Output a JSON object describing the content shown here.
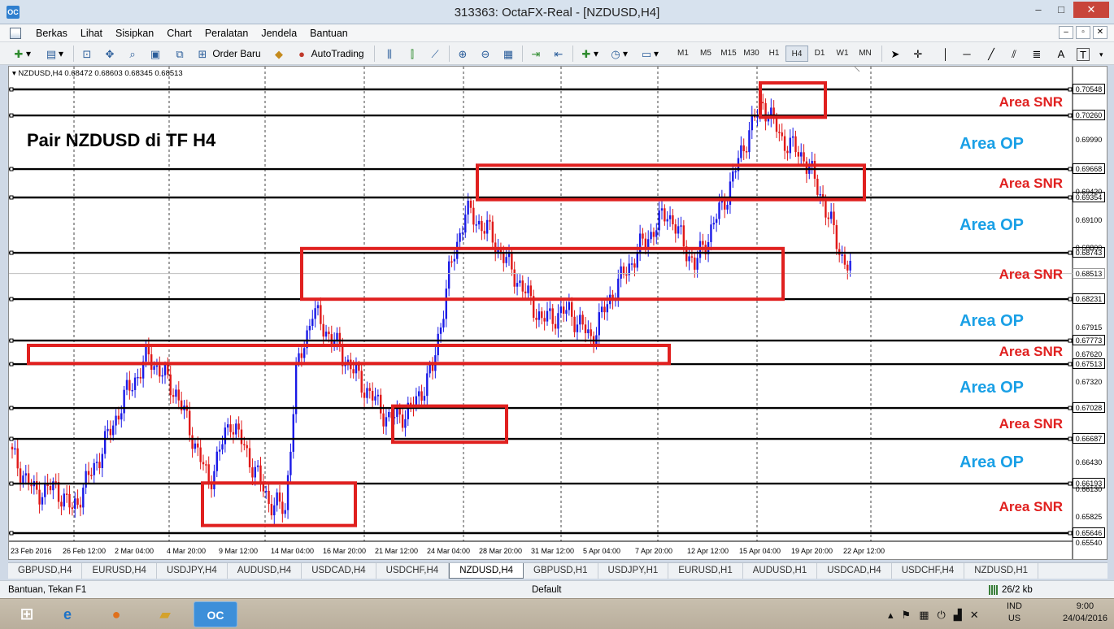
{
  "window": {
    "title": "313363: OctaFX-Real - [NZDUSD,H4]",
    "app_icon": "OC",
    "controls": [
      "–",
      "□",
      "✕"
    ]
  },
  "menu": {
    "items": [
      "Berkas",
      "Lihat",
      "Sisipkan",
      "Chart",
      "Peralatan",
      "Jendela",
      "Bantuan"
    ],
    "mdi_controls": [
      "–",
      "▫",
      "✕"
    ]
  },
  "toolbar": {
    "order_label": "Order Baru",
    "autotrading_label": "AutoTrading",
    "timeframes": [
      "M1",
      "M5",
      "M15",
      "M30",
      "H1",
      "H4",
      "D1",
      "W1",
      "MN"
    ],
    "active_timeframe": "H4",
    "text_tool": "A",
    "label_tool": "T"
  },
  "chart": {
    "symbol_line": "NZDUSD,H4  0.68472 0.68603 0.68345 0.68513",
    "title": "Pair NZDUSD di TF H4",
    "current_price": "0.68513",
    "levels": [
      {
        "price": "0.70548",
        "value": 0.70548
      },
      {
        "price": "0.70260",
        "value": 0.7026
      },
      {
        "price": "0.69668",
        "value": 0.69668
      },
      {
        "price": "0.69354",
        "value": 0.69354
      },
      {
        "price": "0.68743",
        "value": 0.68743
      },
      {
        "price": "0.68231",
        "value": 0.68231
      },
      {
        "price": "0.67773",
        "value": 0.67773
      },
      {
        "price": "0.67513",
        "value": 0.67513
      },
      {
        "price": "0.67028",
        "value": 0.67028
      },
      {
        "price": "0.66687",
        "value": 0.66687
      },
      {
        "price": "0.66193",
        "value": 0.66193
      },
      {
        "price": "0.65646",
        "value": 0.65646
      }
    ],
    "axis_prices": [
      "0.69990",
      "0.69420",
      "0.69100",
      "0.68800",
      "0.67915",
      "0.67620",
      "0.67320",
      "0.66430",
      "0.66130",
      "0.65825",
      "0.65540"
    ],
    "axis_price_values": [
      0.6999,
      0.6942,
      0.691,
      0.688,
      0.67915,
      0.6762,
      0.6732,
      0.6643,
      0.6613,
      0.65825,
      0.6554
    ],
    "time_labels": [
      "23 Feb 2016",
      "26 Feb 12:00",
      "2 Mar 04:00",
      "4 Mar 20:00",
      "9 Mar 12:00",
      "14 Mar 04:00",
      "16 Mar 20:00",
      "21 Mar 12:00",
      "24 Mar 04:00",
      "28 Mar 20:00",
      "31 Mar 12:00",
      "5 Apr 04:00",
      "7 Apr 20:00",
      "12 Apr 12:00",
      "15 Apr 04:00",
      "19 Apr 20:00",
      "22 Apr 12:00"
    ],
    "zones": [
      {
        "kind": "snr",
        "label": "Area SNR"
      },
      {
        "kind": "op",
        "label": "Area OP"
      },
      {
        "kind": "snr",
        "label": "Area SNR"
      },
      {
        "kind": "op",
        "label": "Area OP"
      },
      {
        "kind": "snr",
        "label": "Area SNR"
      },
      {
        "kind": "op",
        "label": "Area OP"
      },
      {
        "kind": "snr",
        "label": "Area SNR"
      },
      {
        "kind": "op",
        "label": "Area OP"
      },
      {
        "kind": "snr",
        "label": "Area SNR"
      },
      {
        "kind": "op",
        "label": "Area OP"
      },
      {
        "kind": "snr",
        "label": "Area SNR"
      }
    ],
    "colors": {
      "bull": "#1a1ae6",
      "bear": "#e01818",
      "snr": "#e0201f",
      "op": "#1aa0e6"
    }
  },
  "tabs": [
    "GBPUSD,H4",
    "EURUSD,H4",
    "USDJPY,H4",
    "AUDUSD,H4",
    "USDCAD,H4",
    "USDCHF,H4",
    "NZDUSD,H4",
    "GBPUSD,H1",
    "USDJPY,H1",
    "EURUSD,H1",
    "AUDUSD,H1",
    "USDCAD,H4",
    "USDCHF,H4",
    "NZDUSD,H1"
  ],
  "active_tab": "NZDUSD,H4",
  "status": {
    "help": "Bantuan, Tekan F1",
    "profile": "Default",
    "traffic": "26/2 kb"
  },
  "taskbar": {
    "lang_top": "IND",
    "lang_bottom": "US",
    "time": "9:00",
    "date": "24/04/2016",
    "active_app": "OC"
  }
}
